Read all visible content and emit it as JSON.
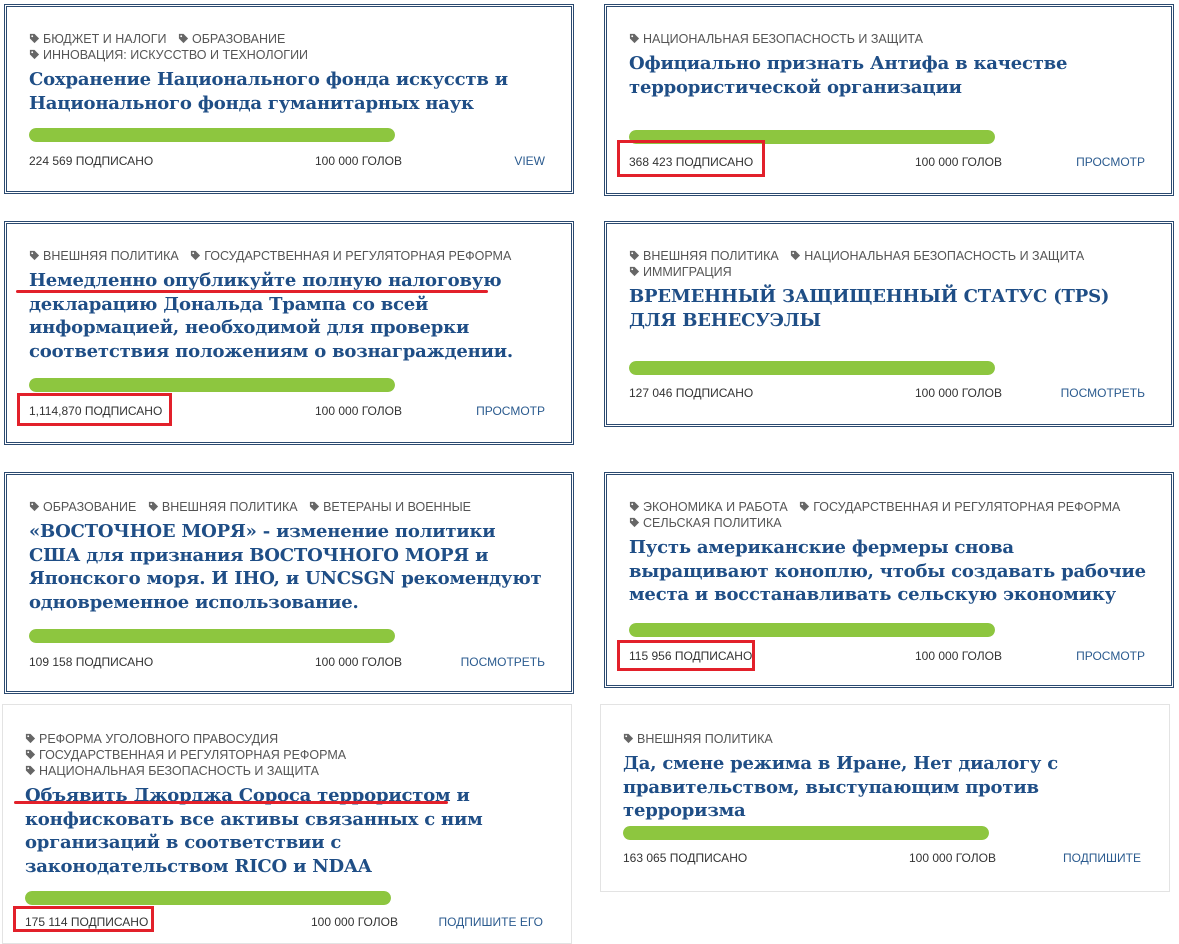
{
  "cards": [
    {
      "tags": [
        "БЮДЖЕТ И НАЛОГИ",
        "ОБРАЗОВАНИЕ",
        "ИННОВАЦИЯ: ИСКУССТВО И ТЕХНОЛОГИИ"
      ],
      "title": "Сохранение Национального фонда искусств и Национального фонда гуманитарных наук",
      "signed": "224 569 ПОДПИСАНО",
      "goal": "100 000 ГОЛОВ",
      "action": "VIEW",
      "progress": 1.0
    },
    {
      "tags": [
        "НАЦИОНАЛЬНАЯ БЕЗОПАСНОСТЬ И ЗАЩИТА"
      ],
      "title": "Официально признать Антифа в качестве террористической организации",
      "signed": "368 423 ПОДПИСАНО",
      "goal": "100 000 ГОЛОВ",
      "action": "ПРОСМОТР",
      "progress": 1.0
    },
    {
      "tags": [
        "ВНЕШНЯЯ ПОЛИТИКА",
        "ГОСУДАРСТВЕННАЯ И РЕГУЛЯТОРНАЯ РЕФОРМА"
      ],
      "title": "Немедленно опубликуйте полную налоговую декларацию Дональда Трампа со всей информацией, необходимой для проверки соответствия положениям о вознаграждении.",
      "signed": "1,114,870 ПОДПИСАНО",
      "goal": "100 000 ГОЛОВ",
      "action": "ПРОСМОТР",
      "progress": 1.0
    },
    {
      "tags": [
        "ВНЕШНЯЯ ПОЛИТИКА",
        "НАЦИОНАЛЬНАЯ БЕЗОПАСНОСТЬ И ЗАЩИТА",
        "ИММИГРАЦИЯ"
      ],
      "title": "ВРЕМЕННЫЙ ЗАЩИЩЕННЫЙ СТАТУС (TPS) ДЛЯ ВЕНЕСУЭЛЫ",
      "signed": "127 046 ПОДПИСАНО",
      "goal": "100 000 ГОЛОВ",
      "action": "ПОСМОТРЕТЬ",
      "progress": 1.0
    },
    {
      "tags": [
        "ОБРАЗОВАНИЕ",
        "ВНЕШНЯЯ ПОЛИТИКА",
        "ВЕТЕРАНЫ И ВОЕННЫЕ"
      ],
      "title": "«ВОСТОЧНОЕ МОРЯ» - изменение политики США для признания ВОСТОЧНОГО МОРЯ и Японского моря. И IHO, и UNCSGN рекомендуют одновременное использование.",
      "signed": "109 158 ПОДПИСАНО",
      "goal": "100 000 ГОЛОВ",
      "action": "ПОСМОТРЕТЬ",
      "progress": 1.0
    },
    {
      "tags": [
        "ЭКОНОМИКА И РАБОТА",
        "ГОСУДАРСТВЕННАЯ И РЕГУЛЯТОРНАЯ РЕФОРМА",
        "СЕЛЬСКАЯ ПОЛИТИКА"
      ],
      "title": "Пусть американские фермеры снова выращивают коноплю, чтобы создавать рабочие места и восстанавливать сельскую экономику",
      "signed": "115 956 ПОДПИСАНО",
      "goal": "100 000 ГОЛОВ",
      "action": "ПРОСМОТР",
      "progress": 1.0
    },
    {
      "tags": [
        "РЕФОРМА УГОЛОВНОГО ПРАВОСУДИЯ",
        "ГОСУДАРСТВЕННАЯ И РЕГУЛЯТОРНАЯ РЕФОРМА",
        "НАЦИОНАЛЬНАЯ БЕЗОПАСНОСТЬ И ЗАЩИТА"
      ],
      "title": "Объявить Джорджа Сороса террористом и конфисковать все активы связанных с ним организаций в соответствии с законодательством RICO и NDAA",
      "signed": "175 114 ПОДПИСАНО",
      "goal": "100 000 ГОЛОВ",
      "action": "ПОДПИШИТЕ ЕГО",
      "progress": 1.0
    },
    {
      "tags": [
        "ВНЕШНЯЯ ПОЛИТИКА"
      ],
      "title": "Да, смене режима в Иране, Нет диалогу с правительством, выступающим против терроризма",
      "signed": "163 065 ПОДПИСАНО",
      "goal": "100 000 ГОЛОВ",
      "action": "ПОДПИШИТЕ",
      "progress": 1.0
    }
  ],
  "colors": {
    "border": "#2b4a70",
    "title": "#1f4e86",
    "progress": "#8dc63f",
    "link": "#2b5b8f",
    "highlight": "#e2202a"
  },
  "icons": {
    "tag": "tag-icon"
  }
}
